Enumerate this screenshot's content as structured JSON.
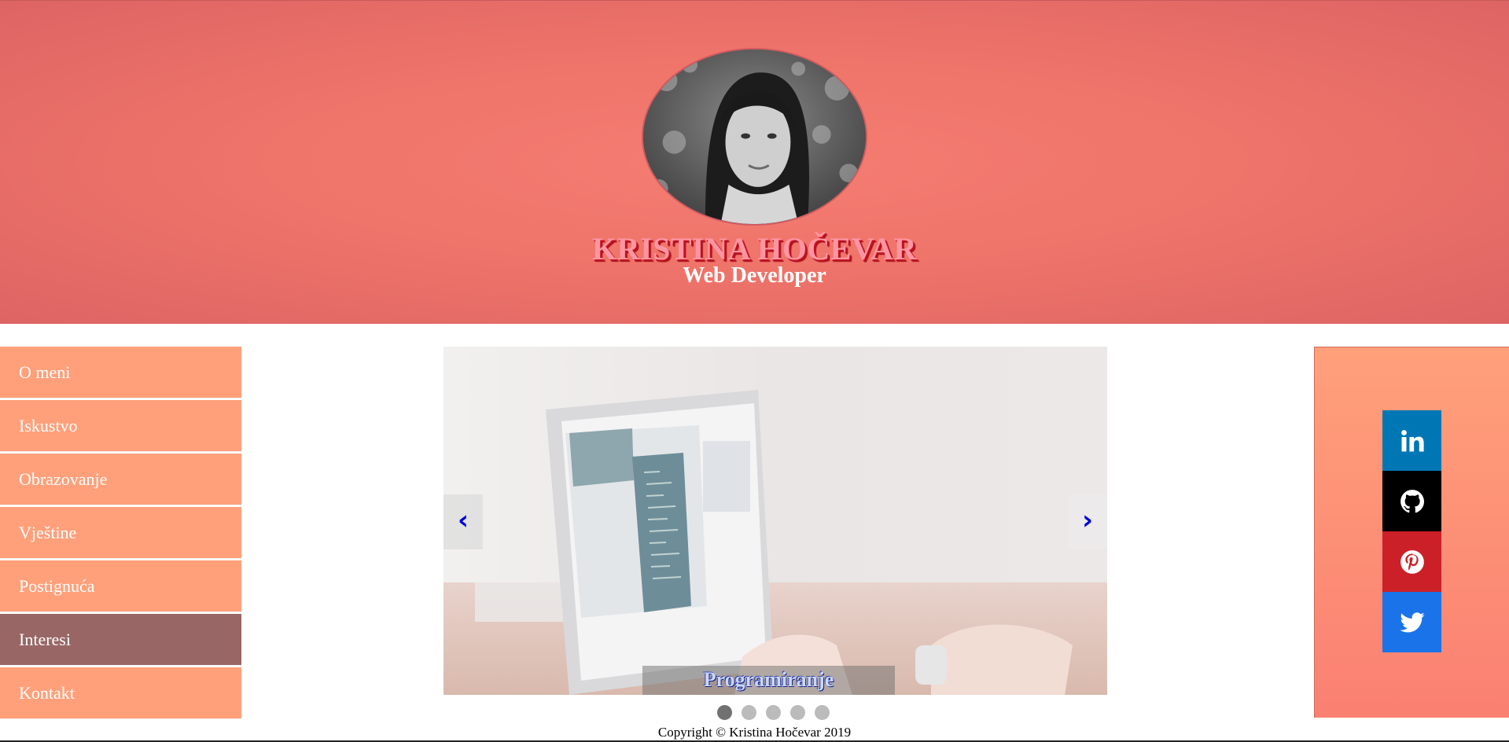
{
  "header": {
    "name": "KRISTINA HOČEVAR",
    "subtitle": "Web Developer"
  },
  "sidebar": {
    "items": [
      {
        "label": "O meni",
        "active": false
      },
      {
        "label": "Iskustvo",
        "active": false
      },
      {
        "label": "Obrazovanje",
        "active": false
      },
      {
        "label": "Vještine",
        "active": false
      },
      {
        "label": "Postignuća",
        "active": false
      },
      {
        "label": "Interesi",
        "active": true
      },
      {
        "label": "Kontakt",
        "active": false
      }
    ],
    "colors": {
      "item": "#ffa07a",
      "active": "#996666"
    }
  },
  "slider": {
    "prev_label": "‹",
    "next_label": "›",
    "caption": "Programiranje",
    "slide_count": 5,
    "active_slide": 1
  },
  "social": [
    {
      "icon": "linkedin-icon",
      "color": "#0077b5"
    },
    {
      "icon": "github-icon",
      "color": "#000000"
    },
    {
      "icon": "pinterest-icon",
      "color": "#cb2027"
    },
    {
      "icon": "twitter-icon",
      "color": "#1a73e8"
    }
  ],
  "footer": {
    "copyright": "Copyright © Kristina Hočevar 2019"
  }
}
